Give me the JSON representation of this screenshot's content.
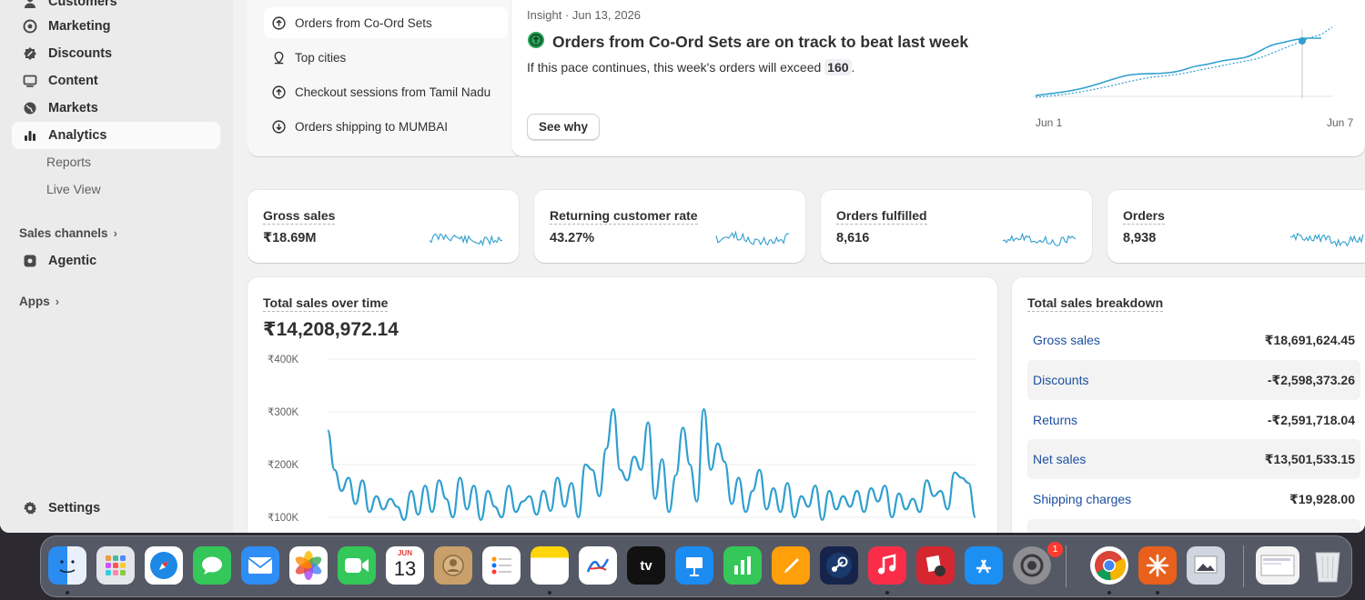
{
  "sidebar": {
    "items": [
      {
        "label": "Customers",
        "icon": "person-icon"
      },
      {
        "label": "Marketing",
        "icon": "target-icon"
      },
      {
        "label": "Discounts",
        "icon": "discount-icon"
      },
      {
        "label": "Content",
        "icon": "content-icon"
      },
      {
        "label": "Markets",
        "icon": "globe-icon"
      },
      {
        "label": "Analytics",
        "icon": "bar-chart-icon",
        "active": true
      }
    ],
    "sub_items": [
      "Reports",
      "Live View"
    ],
    "sales_channels_label": "Sales channels",
    "agentic_label": "Agentic",
    "apps_label": "Apps",
    "settings_label": "Settings"
  },
  "insights": {
    "list": [
      {
        "label": "Orders from Co-Ord Sets",
        "icon": "arrow-up-circle-icon"
      },
      {
        "label": "Top cities",
        "icon": "pin-icon"
      },
      {
        "label": "Checkout sessions from Tamil Nadu",
        "icon": "arrow-up-circle-icon"
      },
      {
        "label": "Orders shipping to MUMBAI",
        "icon": "arrow-down-circle-icon"
      }
    ],
    "meta": "Insight · Jun 13, 2026",
    "title": "Orders from Co-Ord Sets are on track to beat last week",
    "body_prefix": "If this pace continues, this week's orders will exceed",
    "body_value": "160",
    "body_suffix": ".",
    "see_why": "See why",
    "chart_x_start": "Jun 1",
    "chart_x_end": "Jun 7"
  },
  "metrics": [
    {
      "title": "Gross sales",
      "value": "₹18.69M"
    },
    {
      "title": "Returning customer rate",
      "value": "43.27%"
    },
    {
      "title": "Orders fulfilled",
      "value": "8,616"
    },
    {
      "title": "Orders",
      "value": "8,938"
    }
  ],
  "sales_over_time": {
    "title": "Total sales over time",
    "total": "₹14,208,972.14"
  },
  "breakdown": {
    "title": "Total sales breakdown",
    "rows": [
      {
        "label": "Gross sales",
        "value": "₹18,691,624.45"
      },
      {
        "label": "Discounts",
        "value": "-₹2,598,373.26"
      },
      {
        "label": "Returns",
        "value": "-₹2,591,718.04"
      },
      {
        "label": "Net sales",
        "value": "₹13,501,533.15"
      },
      {
        "label": "Shipping charges",
        "value": "₹19,928.00"
      }
    ]
  },
  "calendar_icon": {
    "month": "JUN",
    "day": "13"
  },
  "settings_badge": "1",
  "appletv_label": "tv",
  "colors": {
    "accent": "#2f9fcf",
    "link": "#1d4fa0",
    "positive": "#29a35a"
  },
  "chart_data": {
    "type": "line",
    "title": "Total sales over time",
    "ylabel": "",
    "yticks": [
      "₹400K",
      "₹300K",
      "₹200K",
      "₹100K"
    ],
    "ylim": [
      100000,
      400000
    ],
    "series": [
      {
        "values": [
          265000,
          190000,
          150000,
          175000,
          125000,
          170000,
          110000,
          140000,
          115000,
          135000,
          120000,
          95000,
          150000,
          105000,
          160000,
          110000,
          170000,
          135000,
          100000,
          175000,
          115000,
          160000,
          95000,
          150000,
          120000,
          100000,
          160000,
          110000,
          130000,
          140000,
          105000,
          150000,
          112000,
          175000,
          120000,
          165000,
          100000,
          200000,
          190000,
          140000,
          230000,
          305000,
          190000,
          170000,
          215000,
          190000,
          280000,
          135000,
          210000,
          110000,
          180000,
          270000,
          200000,
          130000,
          305000,
          190000,
          240000,
          205000,
          125000,
          175000,
          110000,
          150000,
          190000,
          115000,
          155000,
          110000,
          165000,
          100000,
          140000,
          120000,
          160000,
          95000,
          150000,
          115000,
          140000,
          120000,
          150000,
          110000,
          155000,
          130000,
          160000,
          100000,
          145000,
          115000,
          135000,
          110000,
          170000,
          140000,
          150000,
          115000,
          185000,
          175000,
          165000,
          100000
        ]
      }
    ]
  }
}
